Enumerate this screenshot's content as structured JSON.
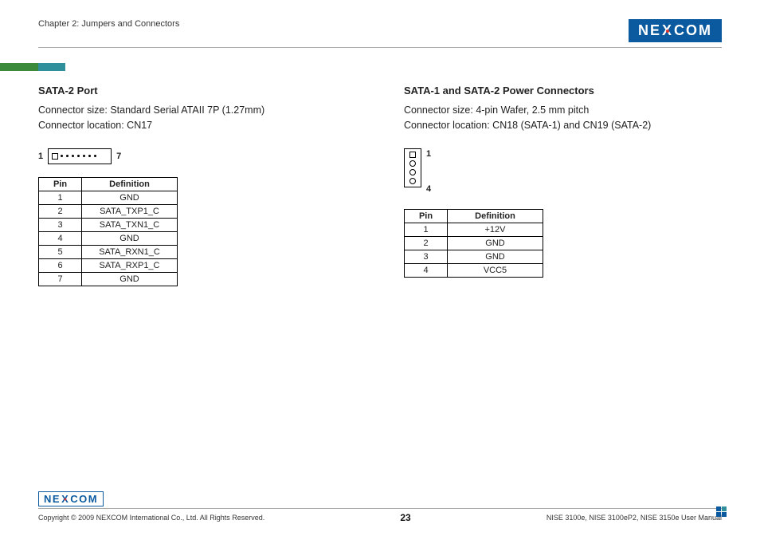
{
  "header": {
    "chapter": "Chapter 2: Jumpers and Connectors",
    "logo_text": "NE COM",
    "logo_x": "X"
  },
  "left": {
    "title": "SATA-2 Port",
    "line1": "Connector size: Standard Serial ATAII 7P (1.27mm)",
    "line2": "Connector location: CN17",
    "pin_left": "1",
    "pin_right": "7",
    "th_pin": "Pin",
    "th_def": "Definition",
    "rows": [
      {
        "pin": "1",
        "def": "GND"
      },
      {
        "pin": "2",
        "def": "SATA_TXP1_C"
      },
      {
        "pin": "3",
        "def": "SATA_TXN1_C"
      },
      {
        "pin": "4",
        "def": "GND"
      },
      {
        "pin": "5",
        "def": "SATA_RXN1_C"
      },
      {
        "pin": "6",
        "def": "SATA_RXP1_C"
      },
      {
        "pin": "7",
        "def": "GND"
      }
    ]
  },
  "right": {
    "title": "SATA-1 and SATA-2 Power Connectors",
    "line1": "Connector size: 4-pin Wafer, 2.5 mm pitch",
    "line2": "Connector location: CN18 (SATA-1) and CN19 (SATA-2)",
    "pin_top": "1",
    "pin_bot": "4",
    "th_pin": "Pin",
    "th_def": "Definition",
    "rows": [
      {
        "pin": "1",
        "def": "+12V"
      },
      {
        "pin": "2",
        "def": "GND"
      },
      {
        "pin": "3",
        "def": "GND"
      },
      {
        "pin": "4",
        "def": "VCC5"
      }
    ]
  },
  "footer": {
    "logo_text": "NE COM",
    "logo_x": "X",
    "copyright": "Copyright © 2009 NEXCOM International Co., Ltd. All Rights Reserved.",
    "page": "23",
    "manual": "NISE 3100e, NISE 3100eP2, NISE 3150e User Manual"
  }
}
